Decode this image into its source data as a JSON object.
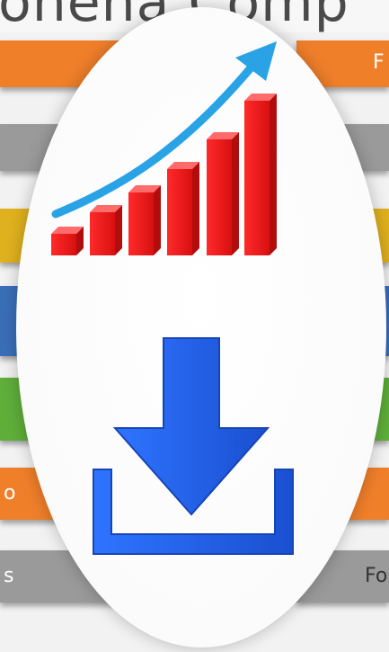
{
  "title": "onena Comp",
  "bands_left": [
    {
      "label": "",
      "color": "#f07f2a"
    },
    {
      "label": "",
      "color": "#9a9a9a"
    },
    {
      "label": "",
      "color": "#e0b11e"
    },
    {
      "label": "",
      "color": "#3a6fb8"
    },
    {
      "label": "",
      "color": "#5fae3a"
    },
    {
      "label": "o",
      "color": "#f07f2a"
    },
    {
      "label": "s",
      "color": "#9a9a9a"
    }
  ],
  "bands_right": [
    {
      "label": "F",
      "color": "#f07f2a"
    },
    {
      "label": "",
      "color": "#9a9a9a"
    },
    {
      "label": "",
      "color": "#e0b11e"
    },
    {
      "label": "",
      "color": "#3a6fb8"
    },
    {
      "label": "",
      "color": "#5fae3a"
    },
    {
      "label": "",
      "color": "#f07f2a"
    },
    {
      "label": "Fo",
      "color": "#9a9a9a"
    }
  ],
  "icons": {
    "growth": "growth-chart-icon",
    "download": "download-icon"
  },
  "colors": {
    "bar_red": "#e01818",
    "arrow_blue": "#29a3e6",
    "download_blue": "#1f5fe0"
  }
}
